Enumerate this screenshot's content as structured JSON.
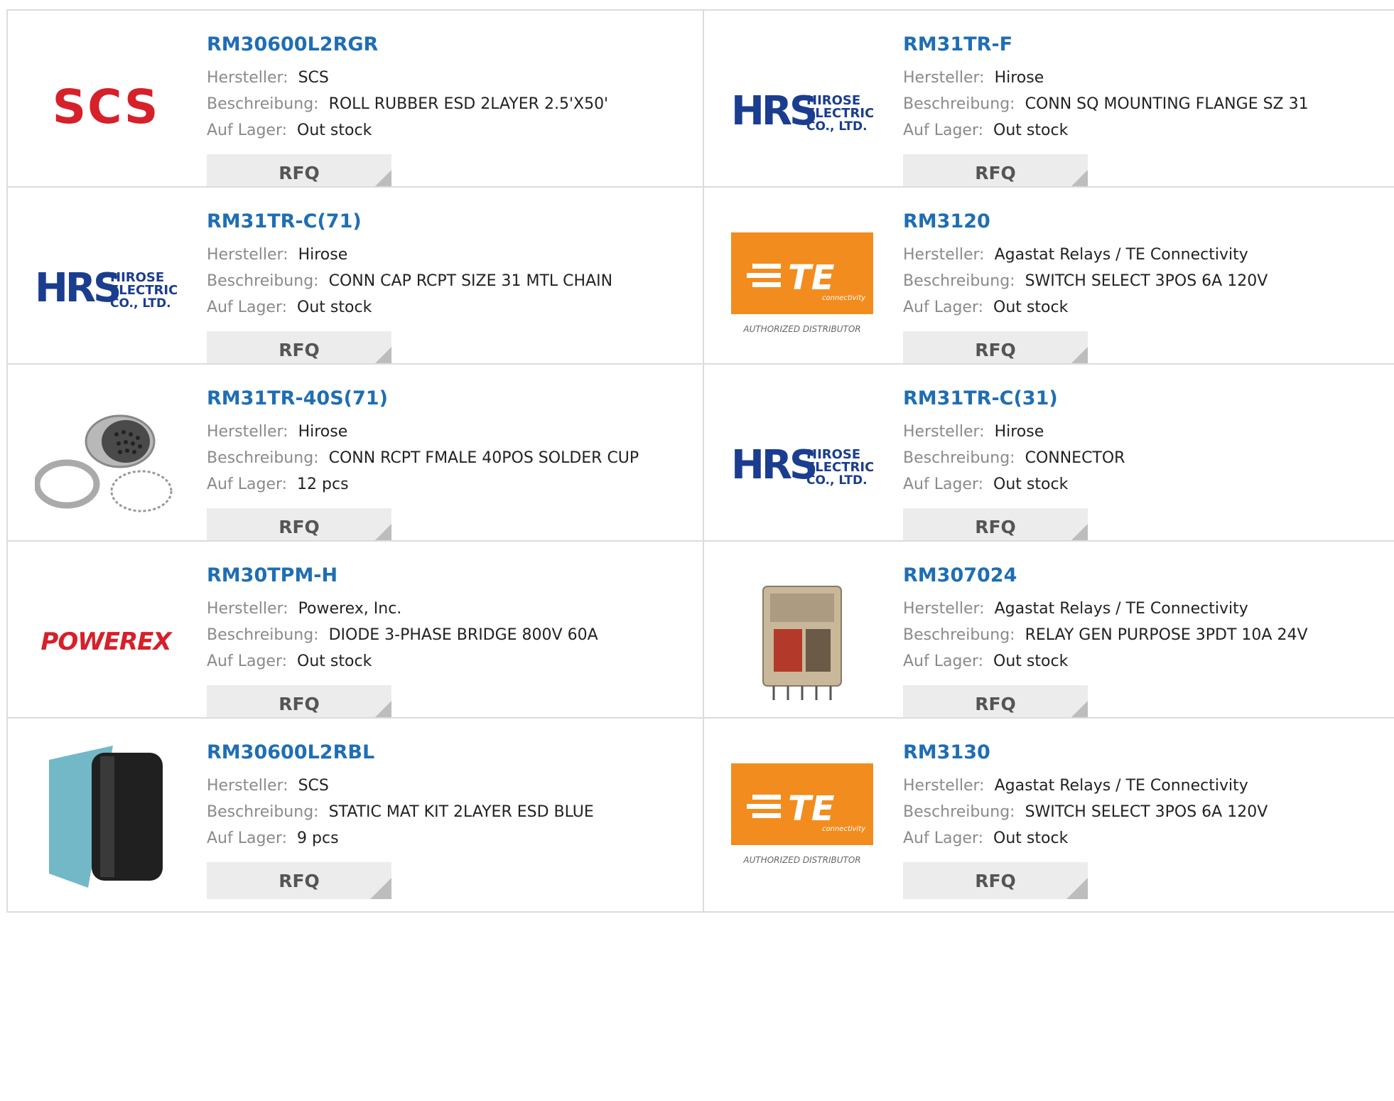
{
  "labels": {
    "manufacturer": "Hersteller:",
    "description": "Beschreibung:",
    "stock": "Auf Lager:",
    "rfq": "RFQ"
  },
  "logo_text": {
    "scs": "SCS",
    "hrs_mark": "HRS",
    "hrs_line1": "HIROSE",
    "hrs_line2": "ELECTRIC",
    "hrs_line3": "CO., LTD.",
    "te_mark": "TE",
    "te_sub": "connectivity",
    "te_dist": "AUTHORIZED DISTRIBUTOR",
    "powerex": "POWEREX"
  },
  "products": [
    {
      "part": "RM30600L2RGR",
      "manufacturer": "SCS",
      "description": "ROLL RUBBER ESD 2LAYER 2.5'X50'",
      "stock": "Out stock",
      "image": "scs-logo"
    },
    {
      "part": "RM31TR-F",
      "manufacturer": "Hirose",
      "description": "CONN SQ MOUNTING FLANGE SZ 31",
      "stock": "Out stock",
      "image": "hirose-logo"
    },
    {
      "part": "RM31TR-C(71)",
      "manufacturer": "Hirose",
      "description": "CONN CAP RCPT SIZE 31 MTL CHAIN",
      "stock": "Out stock",
      "image": "hirose-logo"
    },
    {
      "part": "RM3120",
      "manufacturer": "Agastat Relays / TE Connectivity",
      "description": "SWITCH SELECT 3POS 6A 120V",
      "stock": "Out stock",
      "image": "te-logo"
    },
    {
      "part": "RM31TR-40S(71)",
      "manufacturer": "Hirose",
      "description": "CONN RCPT FMALE 40POS SOLDER CUP",
      "stock": "12 pcs",
      "image": "connector-photo"
    },
    {
      "part": "RM31TR-C(31)",
      "manufacturer": "Hirose",
      "description": "CONNECTOR",
      "stock": "Out stock",
      "image": "hirose-logo"
    },
    {
      "part": "RM30TPM-H",
      "manufacturer": "Powerex, Inc.",
      "description": "DIODE 3-PHASE BRIDGE 800V 60A",
      "stock": "Out stock",
      "image": "powerex-logo"
    },
    {
      "part": "RM307024",
      "manufacturer": "Agastat Relays / TE Connectivity",
      "description": "RELAY GEN PURPOSE 3PDT 10A 24V",
      "stock": "Out stock",
      "image": "relay-photo"
    },
    {
      "part": "RM30600L2RBL",
      "manufacturer": "SCS",
      "description": "STATIC MAT KIT 2LAYER ESD BLUE",
      "stock": "9 pcs",
      "image": "mat-roll-photo"
    },
    {
      "part": "RM3130",
      "manufacturer": "Agastat Relays / TE Connectivity",
      "description": "SWITCH SELECT 3POS 6A 120V",
      "stock": "Out stock",
      "image": "te-logo"
    }
  ]
}
